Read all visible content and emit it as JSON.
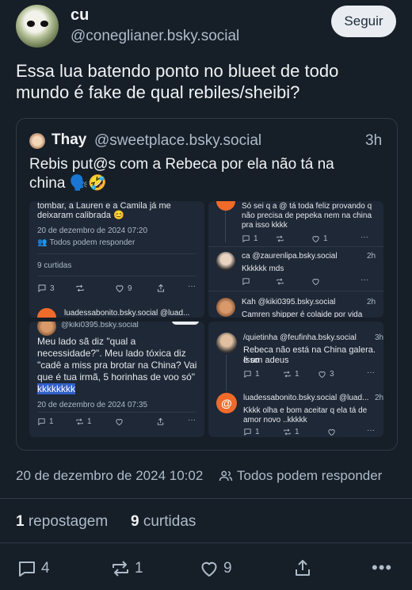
{
  "post": {
    "display_name": "cu",
    "handle": "@coneglianer.bsky.social",
    "follow_label": "Seguir",
    "text_line1": "Essa lua batendo ponto no blueet de todo",
    "text_line2": "mundo é fake de qual rebiles/sheibi?",
    "timestamp": "20 de dezembro de 2024 10:02",
    "reply_setting": "Todos podem responder",
    "repost_count": "1",
    "repost_label": "repostagem",
    "like_count": "9",
    "like_label": "curtidas",
    "actions": {
      "replies": "4",
      "reposts": "1",
      "likes": "9"
    }
  },
  "quote": {
    "display_name": "Thay",
    "handle": "@sweetplace.bsky.social",
    "time": "3h",
    "text_line1": "Rebis put@s com a Rebeca por ela não tá na",
    "text_line2": "china 🗣️🤣"
  },
  "shot_tl": {
    "line1": "tombar, a Lauren e a Camila já me",
    "line2": "deixaram calibrada 😊",
    "date": "20 de dezembro de 2024 07:20",
    "reply_setting": "Todos podem responder",
    "likes": "9 curtidas",
    "act_reply": "3",
    "act_like": "9",
    "next_author": "luadessabonito.bsky.social @luad..."
  },
  "shot_tr": {
    "c1_line1": "Só sei q a @ tá toda feliz provando q",
    "c1_line2": "não precisa de pepeka nem na china",
    "c1_line3": "pra isso kkkk",
    "c1_a1": "1",
    "c1_a2": "1",
    "c2_author": "ca @zaurenlipa.bsky.social",
    "c2_time": "2h",
    "c2_text": "Kkkkkk mds",
    "c3_author": "Kah @kiki0395.bsky.social",
    "c3_time": "2h",
    "c3_text": "Camren shipper é colaide por vida"
  },
  "shot_bl": {
    "author": "@kiki0395.bsky.social",
    "line1": "Meu lado sã diz \"qual a",
    "line2": "necessidade?\". Meu lado tóxica diz",
    "line3": "\"cadê a miss pra brotar na China? Vai",
    "line4": "que é tua irmã, 5 horinhas de voo só\"",
    "line5": "kkkkkkkk",
    "date": "20 de dezembro de 2024 07:35",
    "act_reply": "1",
    "act_like": "1"
  },
  "shot_br": {
    "c1_author": "/quietinha @feufinha.bsky.social",
    "c1_time": "3h",
    "c1_line1": "Rebeca não está na China galera. Isso",
    "c1_line2": "é um adeus",
    "c1_a1": "1",
    "c1_a2": "1",
    "c1_a3": "3",
    "c2_author": "luadessabonito.bsky.social @luad...",
    "c2_time": "2h",
    "c2_line1": "Kkkk olha e bom aceitar q ela tá de",
    "c2_line2": "amor novo ..kkkkk",
    "c2_a1": "1",
    "c2_a2": "1"
  },
  "colors": {
    "background": "#161e27",
    "text": "#f1f3f5",
    "muted": "#aebbc9",
    "orange_avatar": "#f06a2a"
  },
  "icons": [
    "reply-icon",
    "repost-icon",
    "like-icon",
    "share-icon",
    "more-icon",
    "people-icon"
  ]
}
